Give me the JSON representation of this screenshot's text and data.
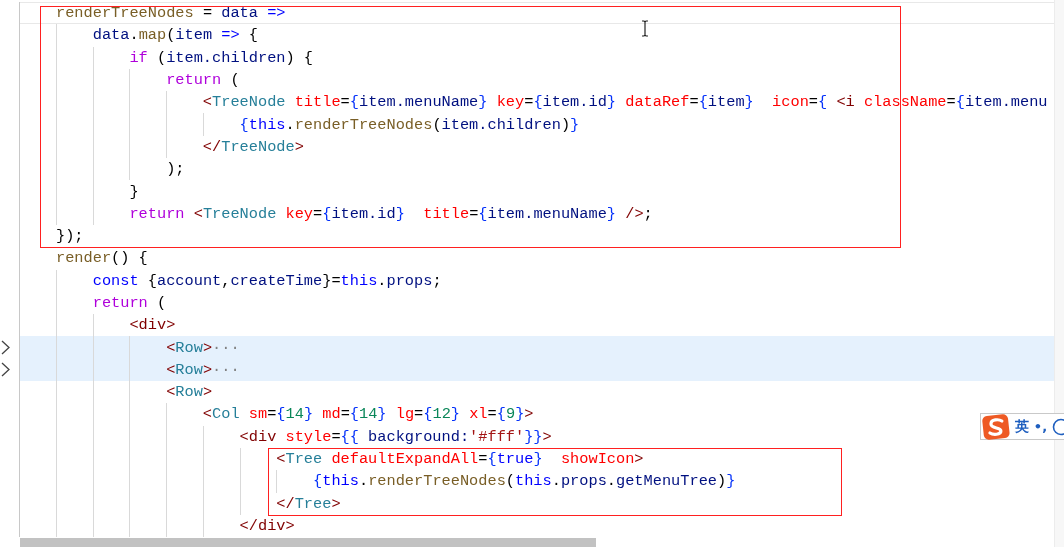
{
  "blocks": [
    {
      "framed": true,
      "lines": [
        {
          "current": true,
          "folded": false,
          "tokens": [
            {
              "text": "renderTreeNodes",
              "kind": "fn"
            },
            {
              "text": " = ",
              "kind": "plain"
            },
            {
              "text": "data",
              "kind": "var"
            },
            {
              "text": " =>",
              "kind": "kw"
            }
          ]
        },
        {
          "current": false,
          "folded": false,
          "tokens": [
            {
              "text": "    data",
              "kind": "var"
            },
            {
              "text": ".",
              "kind": "plain"
            },
            {
              "text": "map",
              "kind": "fn"
            },
            {
              "text": "(",
              "kind": "plain"
            },
            {
              "text": "item",
              "kind": "var"
            },
            {
              "text": " =>",
              "kind": "kw"
            },
            {
              "text": " {",
              "kind": "plain"
            }
          ]
        },
        {
          "current": false,
          "folded": false,
          "tokens": [
            {
              "text": "        if",
              "kind": "ctrl"
            },
            {
              "text": " (",
              "kind": "plain"
            },
            {
              "text": "item.children",
              "kind": "var"
            },
            {
              "text": ") {",
              "kind": "plain"
            }
          ]
        },
        {
          "current": false,
          "folded": false,
          "tokens": [
            {
              "text": "            return",
              "kind": "ctrl"
            },
            {
              "text": " (",
              "kind": "plain"
            }
          ]
        },
        {
          "current": false,
          "folded": false,
          "tokens": [
            {
              "text": "                <",
              "kind": "punct"
            },
            {
              "text": "TreeNode",
              "kind": "tag"
            },
            {
              "text": " title",
              "kind": "attr"
            },
            {
              "text": "=",
              "kind": "plain"
            },
            {
              "text": "{",
              "kind": "brace"
            },
            {
              "text": "item.menuName",
              "kind": "var"
            },
            {
              "text": "}",
              "kind": "brace"
            },
            {
              "text": " key",
              "kind": "attr"
            },
            {
              "text": "=",
              "kind": "plain"
            },
            {
              "text": "{",
              "kind": "brace"
            },
            {
              "text": "item.id",
              "kind": "var"
            },
            {
              "text": "}",
              "kind": "brace"
            },
            {
              "text": " dataRef",
              "kind": "attr"
            },
            {
              "text": "=",
              "kind": "plain"
            },
            {
              "text": "{",
              "kind": "brace"
            },
            {
              "text": "item",
              "kind": "var"
            },
            {
              "text": "}",
              "kind": "brace"
            },
            {
              "text": "  icon",
              "kind": "attr"
            },
            {
              "text": "=",
              "kind": "plain"
            },
            {
              "text": "{",
              "kind": "brace"
            },
            {
              "text": " <i",
              "kind": "punct"
            },
            {
              "text": " className",
              "kind": "attr"
            },
            {
              "text": "=",
              "kind": "plain"
            },
            {
              "text": "{",
              "kind": "brace"
            },
            {
              "text": "item.menu",
              "kind": "var"
            }
          ]
        },
        {
          "current": false,
          "folded": false,
          "tokens": [
            {
              "text": "                    {",
              "kind": "brace"
            },
            {
              "text": "this",
              "kind": "kw"
            },
            {
              "text": ".",
              "kind": "plain"
            },
            {
              "text": "renderTreeNodes",
              "kind": "fn"
            },
            {
              "text": "(",
              "kind": "plain"
            },
            {
              "text": "item.children",
              "kind": "var"
            },
            {
              "text": ")",
              "kind": "plain"
            },
            {
              "text": "}",
              "kind": "brace"
            }
          ]
        },
        {
          "current": false,
          "folded": false,
          "tokens": [
            {
              "text": "                </",
              "kind": "punct"
            },
            {
              "text": "TreeNode",
              "kind": "tag"
            },
            {
              "text": ">",
              "kind": "punct"
            }
          ]
        },
        {
          "current": false,
          "folded": false,
          "tokens": [
            {
              "text": "            );",
              "kind": "plain"
            }
          ]
        },
        {
          "current": false,
          "folded": false,
          "tokens": [
            {
              "text": "        }",
              "kind": "plain"
            }
          ]
        },
        {
          "current": false,
          "folded": false,
          "tokens": [
            {
              "text": "        return",
              "kind": "ctrl"
            },
            {
              "text": " <",
              "kind": "punct"
            },
            {
              "text": "TreeNode",
              "kind": "tag"
            },
            {
              "text": " key",
              "kind": "attr"
            },
            {
              "text": "=",
              "kind": "plain"
            },
            {
              "text": "{",
              "kind": "brace"
            },
            {
              "text": "item.id",
              "kind": "var"
            },
            {
              "text": "}",
              "kind": "brace"
            },
            {
              "text": "  title",
              "kind": "attr"
            },
            {
              "text": "=",
              "kind": "plain"
            },
            {
              "text": "{",
              "kind": "brace"
            },
            {
              "text": "item.menuName",
              "kind": "var"
            },
            {
              "text": "}",
              "kind": "brace"
            },
            {
              "text": " />",
              "kind": "punct"
            },
            {
              "text": ";",
              "kind": "plain"
            }
          ]
        },
        {
          "current": false,
          "folded": false,
          "tokens": [
            {
              "text": "});",
              "kind": "plain"
            }
          ]
        }
      ]
    },
    {
      "framed": false,
      "lines": [
        {
          "current": false,
          "folded": false,
          "tokens": [
            {
              "text": "render",
              "kind": "fn"
            },
            {
              "text": "() {",
              "kind": "plain"
            }
          ]
        },
        {
          "current": false,
          "folded": false,
          "tokens": [
            {
              "text": "    const",
              "kind": "kw"
            },
            {
              "text": " {",
              "kind": "plain"
            },
            {
              "text": "account",
              "kind": "var"
            },
            {
              "text": ",",
              "kind": "plain"
            },
            {
              "text": "createTime",
              "kind": "var"
            },
            {
              "text": "}=",
              "kind": "plain"
            },
            {
              "text": "this",
              "kind": "kw"
            },
            {
              "text": ".",
              "kind": "plain"
            },
            {
              "text": "props",
              "kind": "var"
            },
            {
              "text": ";",
              "kind": "plain"
            }
          ]
        },
        {
          "current": false,
          "folded": false,
          "tokens": [
            {
              "text": "    return",
              "kind": "ctrl"
            },
            {
              "text": " (",
              "kind": "plain"
            }
          ]
        },
        {
          "current": false,
          "folded": false,
          "tokens": [
            {
              "text": "        <div>",
              "kind": "punct"
            }
          ]
        },
        {
          "current": false,
          "folded": true,
          "tokens": [
            {
              "text": "            <",
              "kind": "punct"
            },
            {
              "text": "Row",
              "kind": "tag"
            },
            {
              "text": ">",
              "kind": "punct"
            },
            {
              "text": "···",
              "kind": "fold"
            }
          ]
        },
        {
          "current": false,
          "folded": true,
          "tokens": [
            {
              "text": "            <",
              "kind": "punct"
            },
            {
              "text": "Row",
              "kind": "tag"
            },
            {
              "text": ">",
              "kind": "punct"
            },
            {
              "text": "···",
              "kind": "fold"
            }
          ]
        },
        {
          "current": false,
          "folded": false,
          "tokens": [
            {
              "text": "            <",
              "kind": "punct"
            },
            {
              "text": "Row",
              "kind": "tag"
            },
            {
              "text": ">",
              "kind": "punct"
            }
          ]
        },
        {
          "current": false,
          "folded": false,
          "tokens": [
            {
              "text": "                <",
              "kind": "punct"
            },
            {
              "text": "Col",
              "kind": "tag"
            },
            {
              "text": " sm",
              "kind": "attr"
            },
            {
              "text": "=",
              "kind": "plain"
            },
            {
              "text": "{",
              "kind": "brace"
            },
            {
              "text": "14",
              "kind": "num"
            },
            {
              "text": "}",
              "kind": "brace"
            },
            {
              "text": " md",
              "kind": "attr"
            },
            {
              "text": "=",
              "kind": "plain"
            },
            {
              "text": "{",
              "kind": "brace"
            },
            {
              "text": "14",
              "kind": "num"
            },
            {
              "text": "}",
              "kind": "brace"
            },
            {
              "text": " lg",
              "kind": "attr"
            },
            {
              "text": "=",
              "kind": "plain"
            },
            {
              "text": "{",
              "kind": "brace"
            },
            {
              "text": "12",
              "kind": "num"
            },
            {
              "text": "}",
              "kind": "brace"
            },
            {
              "text": " xl",
              "kind": "attr"
            },
            {
              "text": "=",
              "kind": "plain"
            },
            {
              "text": "{",
              "kind": "brace"
            },
            {
              "text": "9",
              "kind": "num"
            },
            {
              "text": "}",
              "kind": "brace"
            },
            {
              "text": ">",
              "kind": "punct"
            }
          ]
        },
        {
          "current": false,
          "folded": false,
          "tokens": [
            {
              "text": "                    <div",
              "kind": "punct"
            },
            {
              "text": " style",
              "kind": "attr"
            },
            {
              "text": "=",
              "kind": "plain"
            },
            {
              "text": "{{",
              "kind": "brace"
            },
            {
              "text": " background:",
              "kind": "var"
            },
            {
              "text": "'#fff'",
              "kind": "str"
            },
            {
              "text": "}}",
              "kind": "brace"
            },
            {
              "text": ">",
              "kind": "punct"
            }
          ]
        }
      ]
    },
    {
      "framed": true,
      "lines": [
        {
          "current": false,
          "folded": false,
          "tokens": [
            {
              "text": "                        <",
              "kind": "punct"
            },
            {
              "text": "Tree",
              "kind": "tag"
            },
            {
              "text": " defaultExpandAll",
              "kind": "attr"
            },
            {
              "text": "=",
              "kind": "plain"
            },
            {
              "text": "{",
              "kind": "brace"
            },
            {
              "text": "true",
              "kind": "kw"
            },
            {
              "text": "}",
              "kind": "brace"
            },
            {
              "text": "  showIcon",
              "kind": "attr"
            },
            {
              "text": ">",
              "kind": "punct"
            }
          ]
        },
        {
          "current": false,
          "folded": false,
          "tokens": [
            {
              "text": "                            {",
              "kind": "brace"
            },
            {
              "text": "this",
              "kind": "kw"
            },
            {
              "text": ".",
              "kind": "plain"
            },
            {
              "text": "renderTreeNodes",
              "kind": "fn"
            },
            {
              "text": "(",
              "kind": "plain"
            },
            {
              "text": "this",
              "kind": "kw"
            },
            {
              "text": ".",
              "kind": "plain"
            },
            {
              "text": "props",
              "kind": "var"
            },
            {
              "text": ".",
              "kind": "plain"
            },
            {
              "text": "getMenuTree",
              "kind": "var"
            },
            {
              "text": ")",
              "kind": "plain"
            },
            {
              "text": "}",
              "kind": "brace"
            }
          ]
        },
        {
          "current": false,
          "folded": false,
          "tokens": [
            {
              "text": "                        </",
              "kind": "punct"
            },
            {
              "text": "Tree",
              "kind": "tag"
            },
            {
              "text": ">",
              "kind": "punct"
            }
          ]
        }
      ]
    },
    {
      "framed": false,
      "lines": [
        {
          "current": false,
          "folded": false,
          "tokens": [
            {
              "text": "                    </div>",
              "kind": "punct"
            }
          ]
        }
      ]
    }
  ],
  "ime": {
    "mode": "英",
    "punctuation": "•,"
  }
}
